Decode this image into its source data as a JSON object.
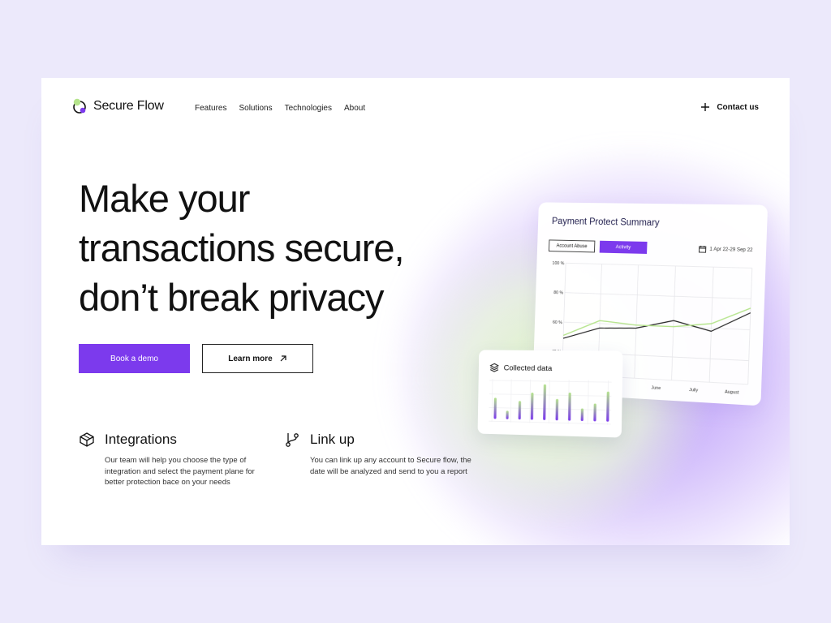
{
  "brand": {
    "name": "Secure Flow"
  },
  "nav": {
    "links": [
      "Features",
      "Solutions",
      "Technologies",
      "About"
    ],
    "contact_label": "Contact us"
  },
  "hero": {
    "title_lines": [
      "Make your",
      "transactions secure,",
      "don’t break privacy"
    ],
    "primary_button": "Book a demo",
    "secondary_button": "Learn more"
  },
  "features": [
    {
      "title": "Integrations",
      "description": "Our team will help you choose the type of integration and select the payment plane for better protection bace on your needs",
      "icon": "cube-icon"
    },
    {
      "title": "Link up",
      "description": "You can link up any account to Secure flow, the date will be analyzed and send to you a report",
      "icon": "git-branch-icon"
    }
  ],
  "summary_card": {
    "title": "Payment Protect Summary",
    "tabs": [
      "Account Abuse",
      "Activity"
    ],
    "active_tab": "Activity",
    "date_range": "1 Apr 22-29 Sep 22"
  },
  "collected_card": {
    "title": "Collected data"
  },
  "colors": {
    "accent": "#7c3aed",
    "green": "#b5e48c",
    "line_dark": "#222222"
  },
  "chart_data": [
    {
      "type": "line",
      "title": "Payment Protect Summary",
      "y_tick_labels": [
        "100 %",
        "80 %",
        "60 %",
        "40 %"
      ],
      "ylim": [
        30,
        100
      ],
      "x_tick_labels": [
        "June",
        "Jully",
        "August"
      ],
      "x": [
        1,
        2,
        3,
        4,
        5,
        6
      ],
      "series": [
        {
          "color": "#222222",
          "values": [
            49,
            57,
            58,
            64,
            58,
            71
          ]
        },
        {
          "color": "#b5e48c",
          "values": [
            51,
            62,
            60,
            60,
            63,
            74
          ]
        }
      ],
      "grid": true
    },
    {
      "type": "bar",
      "title": "Collected data",
      "values": [
        0.55,
        0.22,
        0.48,
        0.7,
        0.92,
        0.55,
        0.72,
        0.32,
        0.45,
        0.76
      ],
      "colors": [
        "#b5e48c",
        "#7c3aed"
      ]
    }
  ]
}
